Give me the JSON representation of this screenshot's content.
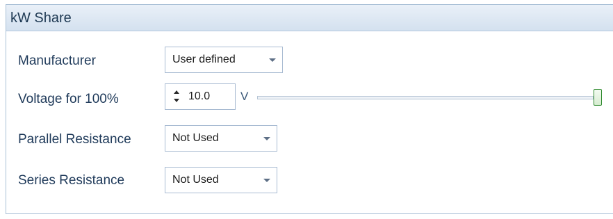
{
  "panel": {
    "title": "kW Share"
  },
  "fields": {
    "manufacturer": {
      "label": "Manufacturer",
      "value": "User defined"
    },
    "voltage_for_100": {
      "label": "Voltage for 100%",
      "value": "10.0",
      "unit": "V",
      "slider_level": 1.0
    },
    "parallel_resistance": {
      "label": "Parallel Resistance",
      "value": "Not Used"
    },
    "series_resistance": {
      "label": "Series Resistance",
      "value": "Not Used"
    }
  },
  "colors": {
    "header_text": "#1e3953",
    "label_text": "#1f3a5a",
    "border": "#a8bbd2",
    "slider_thumb_border": "#2f8a2f"
  }
}
